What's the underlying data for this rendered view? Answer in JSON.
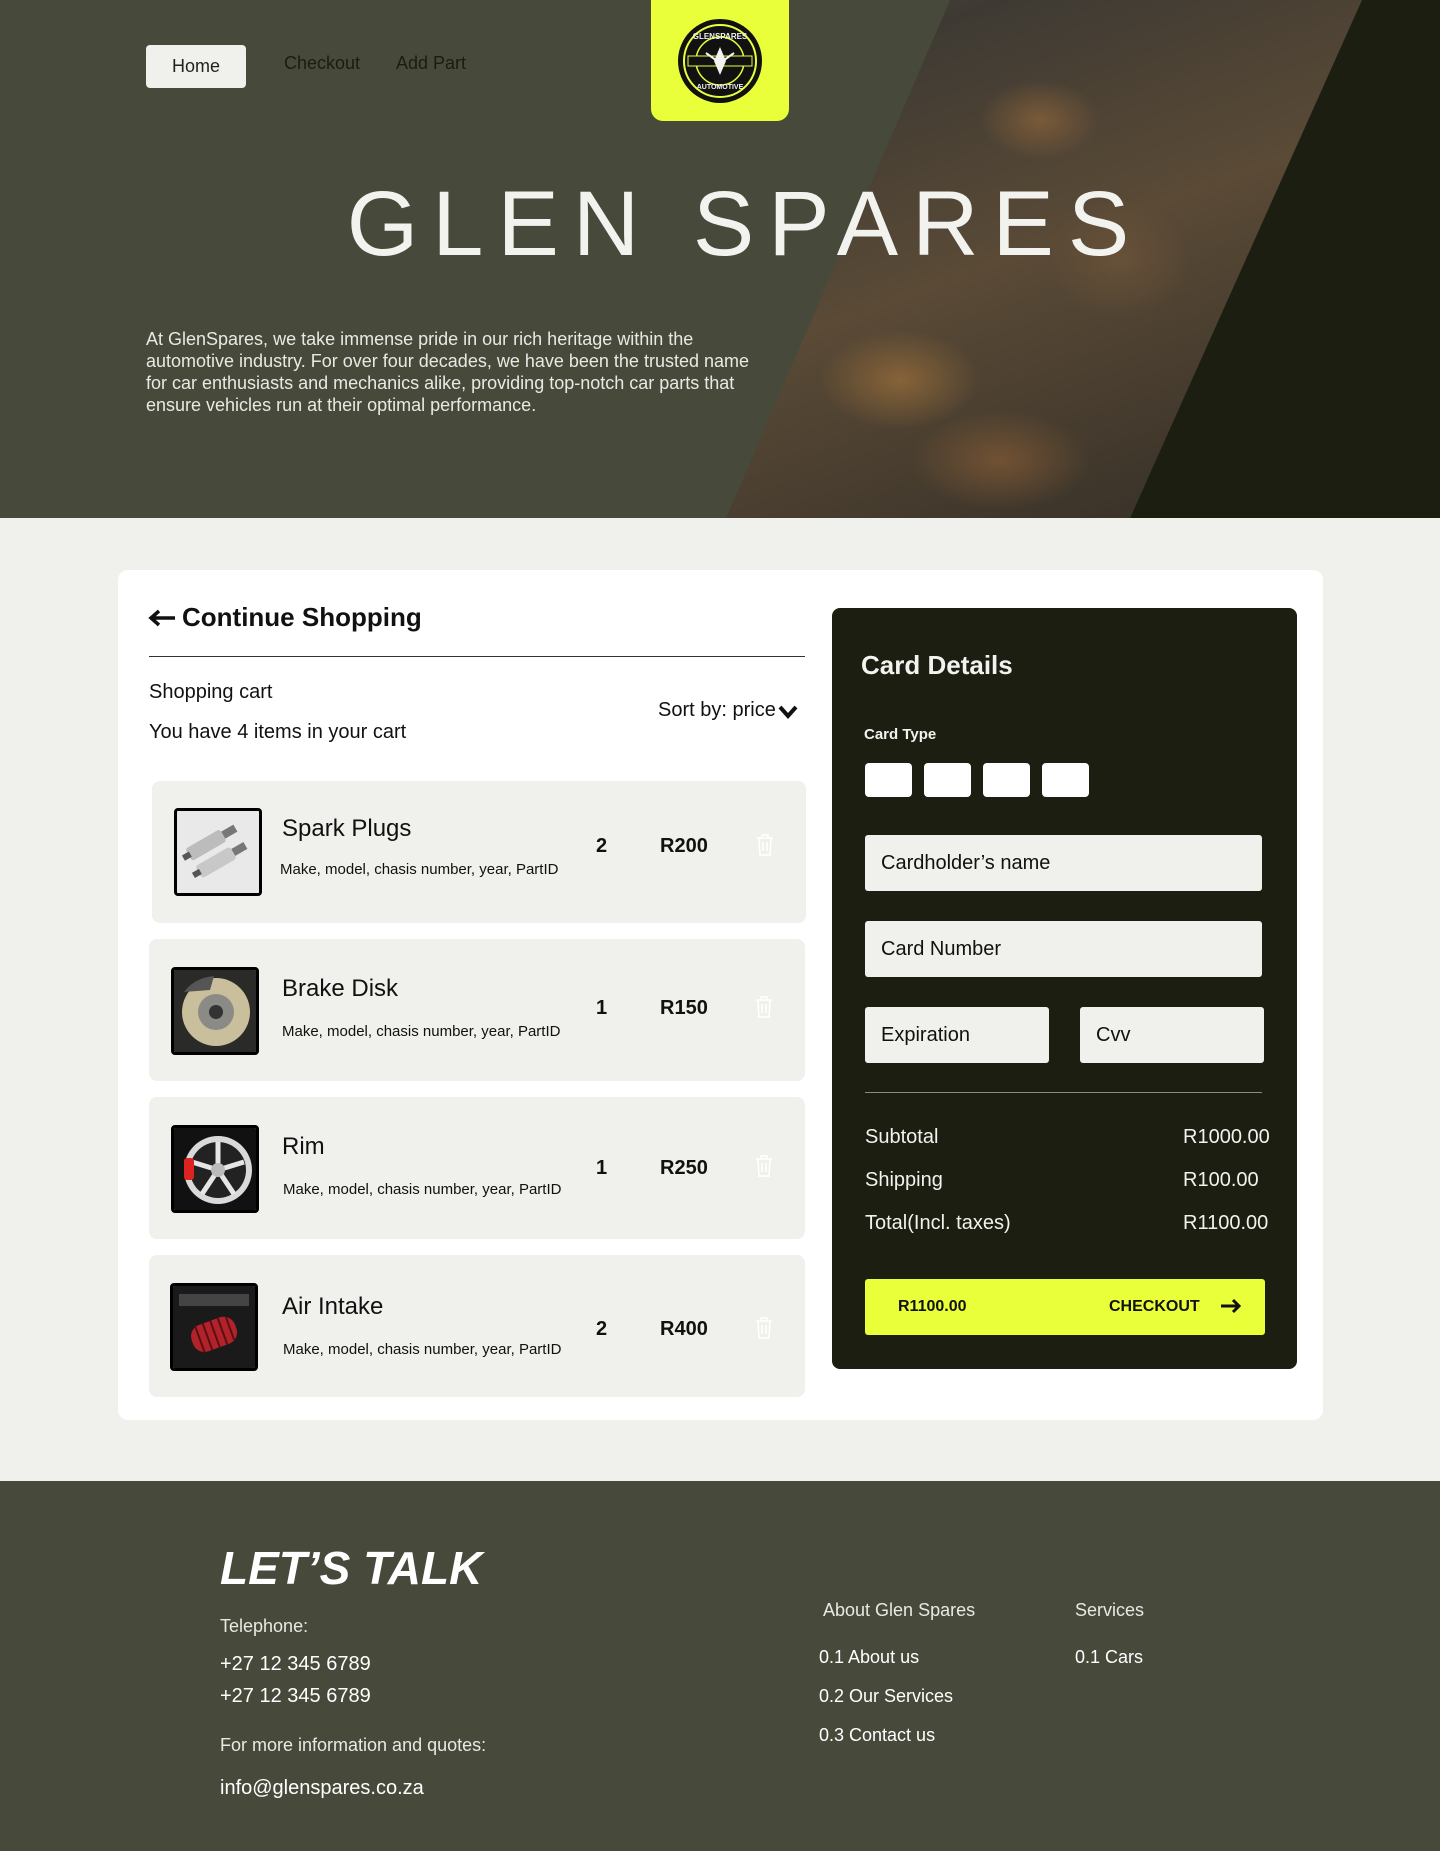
{
  "nav": {
    "home_label": "Home",
    "checkout_label": "Checkout",
    "add_part_label": "Add Part",
    "logo_text_top": "GLENSPARES",
    "logo_text_bottom": "AUTOMOTIVE"
  },
  "hero": {
    "title": "GLEN SPARES",
    "description": "At GlenSpares, we take immense pride in our rich heritage within the automotive industry. For over four decades, we have been the trusted name for car enthusiasts and mechanics alike, providing top-notch car parts that ensure vehicles run at their optimal performance."
  },
  "cart": {
    "continue_label": "Continue Shopping",
    "title": "Shopping cart",
    "count_text": "You have 4 items in your cart",
    "sort_label": "Sort by: price",
    "items": [
      {
        "name": "Spark Plugs",
        "meta": "Make, model, chasis number, year, PartID",
        "qty": "2",
        "price": "R200",
        "thumb_icon": "spark-plug-icon"
      },
      {
        "name": "Brake Disk",
        "meta": "Make, model, chasis number, year, PartID",
        "qty": "1",
        "price": "R150",
        "thumb_icon": "brake-disk-icon"
      },
      {
        "name": "Rim",
        "meta": "Make, model, chasis number, year, PartID",
        "qty": "1",
        "price": "R250",
        "thumb_icon": "rim-icon"
      },
      {
        "name": "Air Intake",
        "meta": "Make, model, chasis number, year, PartID",
        "qty": "2",
        "price": "R400",
        "thumb_icon": "air-intake-icon"
      }
    ]
  },
  "card_details": {
    "title": "Card Details",
    "card_type_label": "Card Type",
    "cardholder_placeholder": "Cardholder’s name",
    "card_number_placeholder": "Card Number",
    "expiration_placeholder": "Expiration",
    "cvv_placeholder": "Cvv",
    "subtotal_label": "Subtotal",
    "subtotal_value": "R1000.00",
    "shipping_label": "Shipping",
    "shipping_value": "R100.00",
    "total_label": "Total(Incl. taxes)",
    "total_value": "R1100.00",
    "checkout_amount": "R1100.00",
    "checkout_label": "CHECKOUT"
  },
  "footer": {
    "title": "LET’S TALK",
    "telephone_label": "Telephone:",
    "phone_1": "+27 12 345 6789",
    "phone_2": "+27 12 345 6789",
    "info_label": "For more information and quotes:",
    "email": "info@glenspares.co.za",
    "about_heading": "About Glen Spares",
    "about_links": [
      "0.1 About us",
      "0.2 Our Services",
      "0.3 Contact us"
    ],
    "services_heading": "Services",
    "services_links": [
      "0.1 Cars"
    ]
  },
  "colors": {
    "accent": "#e8ff3a",
    "olive": "#474a3b",
    "dark": "#1c1e12",
    "light": "#f0f0ec"
  }
}
